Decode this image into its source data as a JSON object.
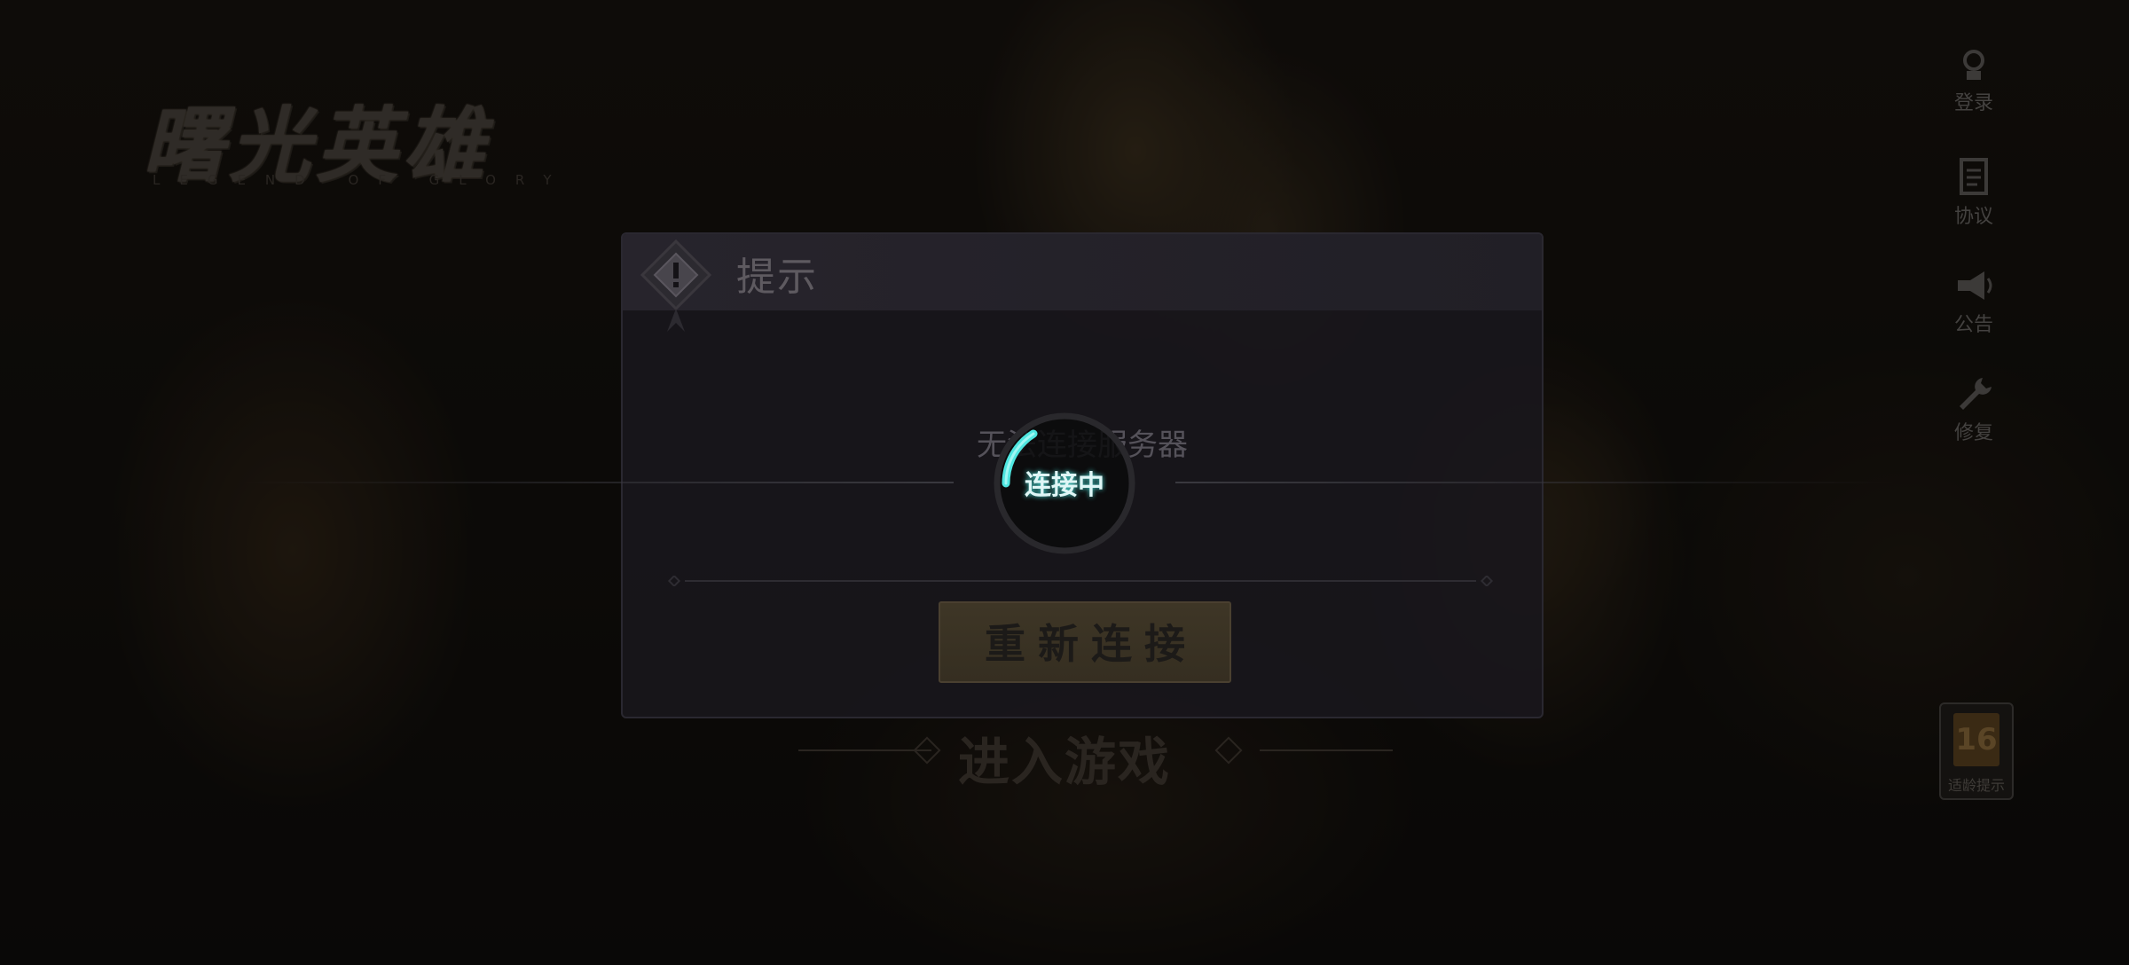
{
  "game": {
    "logo_title": "曙光英雄",
    "logo_subtitle": "LEGEND OF GLORY"
  },
  "side_menu": [
    {
      "label": "登录",
      "icon": "account-icon"
    },
    {
      "label": "协议",
      "icon": "document-icon"
    },
    {
      "label": "公告",
      "icon": "megaphone-icon"
    },
    {
      "label": "修复",
      "icon": "wrench-icon"
    }
  ],
  "age_badge": {
    "caption": "适龄提示",
    "rating": "16"
  },
  "enter_game_label": "进入游戏",
  "dialog": {
    "title": "提示",
    "message": "无法连接服务器",
    "retry_label": "重新连接"
  },
  "loading": {
    "label": "连接中",
    "accent": "#4ee6e0"
  },
  "colors": {
    "accent": "#4ee6e0",
    "button": "#3e3626"
  }
}
